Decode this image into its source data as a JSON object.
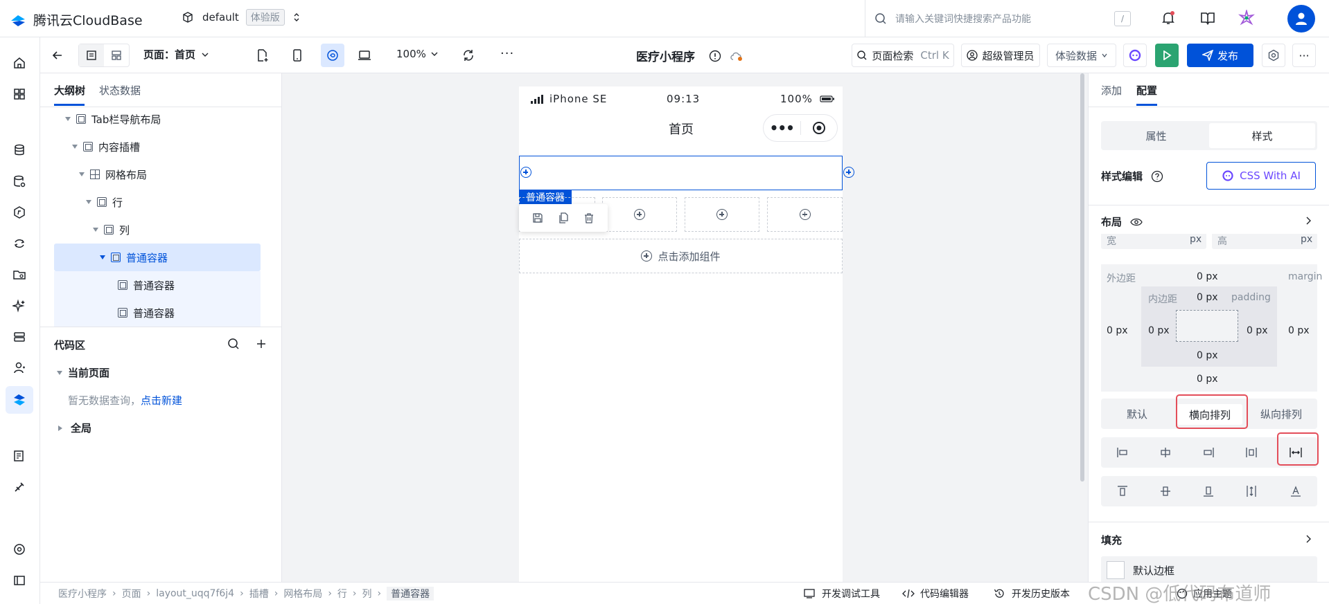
{
  "topbar": {
    "brand": "腾讯云CloudBase",
    "env_name": "default",
    "env_badge": "体验版",
    "search_placeholder": "请输入关键词快捷搜索产品功能",
    "search_shortcut": "/"
  },
  "toolbar": {
    "page_label": "页面：首页",
    "zoom": "100%",
    "app_title": "医疗小程序",
    "page_search": "页面检索",
    "page_search_shortcut": "Ctrl K",
    "role": "超级管理员",
    "data_mode": "体验数据",
    "publish": "发布"
  },
  "outline": {
    "tabs": [
      "大纲树",
      "状态数据"
    ],
    "tree": [
      {
        "label": "Tab栏导航布局",
        "icon": "box"
      },
      {
        "label": "内容插槽",
        "icon": "box"
      },
      {
        "label": "网格布局",
        "icon": "grid"
      },
      {
        "label": "行",
        "icon": "box"
      },
      {
        "label": "列",
        "icon": "box"
      },
      {
        "label": "普通容器",
        "icon": "box"
      },
      {
        "label": "普通容器",
        "icon": "box"
      },
      {
        "label": "普通容器",
        "icon": "box"
      }
    ],
    "code_area": {
      "title": "代码区",
      "current_page": "当前页面",
      "empty_text": "暂无数据查询，",
      "create_link": "点击新建",
      "global": "全局"
    }
  },
  "phone": {
    "device": "iPhone SE",
    "time": "09:13",
    "battery": "100%",
    "title": "首页",
    "selected_label": "普通容器",
    "add_component": "点击添加组件"
  },
  "right": {
    "tabs": [
      "添加",
      "配置"
    ],
    "seg": [
      "属性",
      "样式"
    ],
    "style_edit": "样式编辑",
    "css_ai": "CSS With AI",
    "layout": "布局",
    "width_label": "宽",
    "height_label": "高",
    "unit": "px",
    "margin_cn": "外边距",
    "margin_en": "margin",
    "padding_cn": "内边距",
    "padding_en": "padding",
    "zero_px": "0 px",
    "direction": [
      "默认",
      "横向排列",
      "纵向排列"
    ],
    "fill": "填充",
    "default_border": "默认边框"
  },
  "statusbar": {
    "breadcrumb": [
      "医疗小程序",
      "页面",
      "layout_uqq7f6j4",
      "插槽",
      "网格布局",
      "行",
      "列",
      "普通容器"
    ],
    "dev_tools": "开发调试工具",
    "code_editor": "代码编辑器",
    "history": "开发历史版本",
    "theme": "应用主题",
    "watermark": "CSDN @低代码布道师"
  },
  "colors": {
    "primary": "#0052d9",
    "highlight_red": "#e34d59",
    "green": "#2ba471",
    "selected_row": "#dbe8ff"
  }
}
